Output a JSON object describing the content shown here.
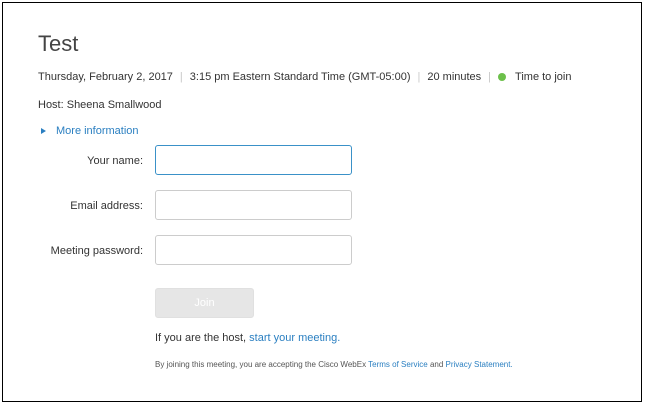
{
  "meeting": {
    "title": "Test",
    "date": "Thursday, February 2, 2017",
    "time": "3:15 pm Eastern Standard Time (GMT-05:00)",
    "duration": "20 minutes",
    "status": "Time to join",
    "status_color": "#6cc04a",
    "host_label": "Host: Sheena Smallwood",
    "more_info": "More information"
  },
  "form": {
    "name_label": "Your name:",
    "name_value": "",
    "email_label": "Email address:",
    "email_value": "",
    "password_label": "Meeting password:",
    "password_value": "",
    "join_label": "Join"
  },
  "footer": {
    "host_prefix": "If you are the host, ",
    "host_link": "start your meeting.",
    "legal_prefix": "By joining this meeting, you are accepting the Cisco WebEx ",
    "terms_link": "Terms of Service",
    "legal_and": " and ",
    "privacy_link": "Privacy Statement."
  }
}
